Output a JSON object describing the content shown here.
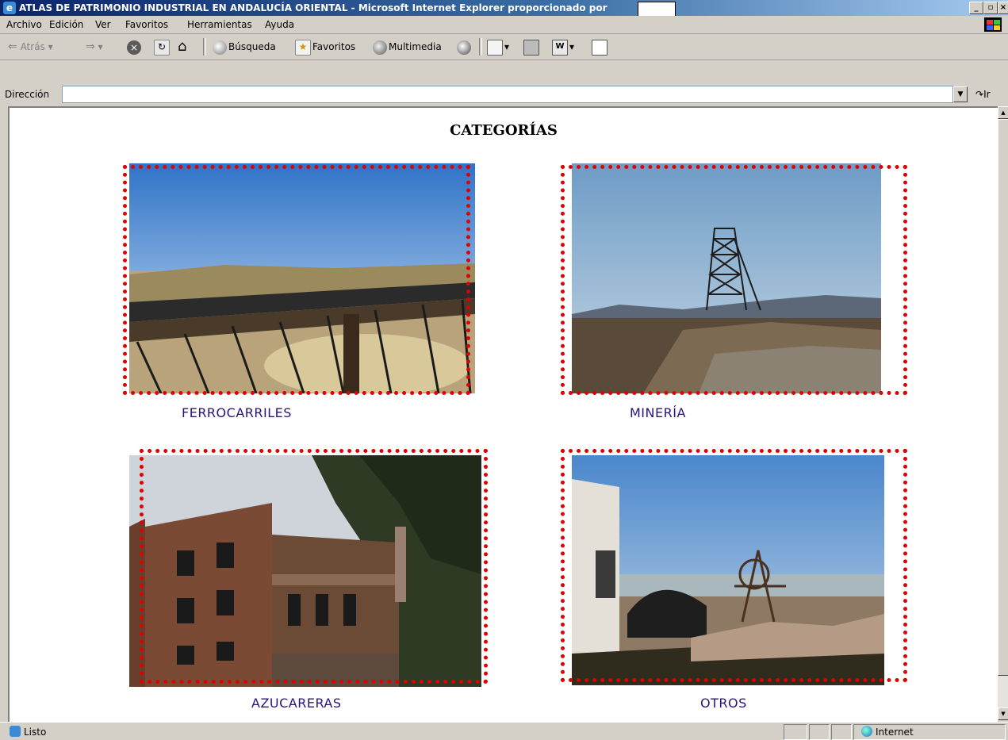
{
  "window": {
    "title": "ATLAS DE PATRIMONIO INDUSTRIAL EN ANDALUCÍA ORIENTAL - Microsoft Internet Explorer proporcionado por",
    "controls": [
      "_",
      "▫",
      "×"
    ]
  },
  "menu": [
    "Archivo",
    "Edición",
    "Ver",
    "Favoritos",
    "Herramientas",
    "Ayuda"
  ],
  "toolbar": {
    "back": "Atrás",
    "search": "Búsqueda",
    "favorites": "Favoritos",
    "media": "Multimedia"
  },
  "address": {
    "label": "Dirección",
    "value": "",
    "go": "Ir"
  },
  "page": {
    "heading": "CATEGORÍAS",
    "categories": [
      "FERROCARRILES",
      "MINERÍA",
      "AZUCARERAS",
      "OTROS"
    ]
  },
  "status": {
    "text": "Listo",
    "zone": "Internet"
  },
  "colors": {
    "frame": "#e00000",
    "caption": "#2a147a"
  }
}
